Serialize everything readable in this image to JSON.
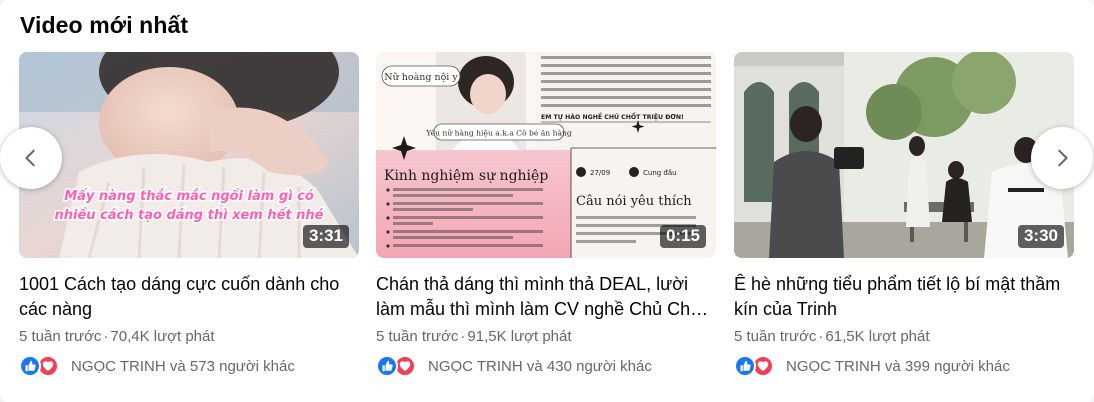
{
  "section": {
    "title": "Video mới nhất"
  },
  "colors": {
    "like": "#1877f2",
    "love": "#f33e58",
    "meta_text": "#65676b"
  },
  "videos": [
    {
      "duration": "3:31",
      "thumb_caption": "Mấy nàng thắc mắc ngồi làm gì có nhiều cách tạo dáng thì xem hết nhé",
      "title": "1001 Cách tạo dáng cực cuốn dành cho các nàng",
      "age": "5 tuần trước",
      "views": "70,4K lượt phát",
      "reactions_text": "NGỌC TRINH và 573 người khác"
    },
    {
      "duration": "0:15",
      "thumb_text": {
        "tag1": "Nữ hoàng nội y",
        "tag2": "Yêu nữ hàng hiệu a.k.a Cô bé ăn hàng",
        "heading_left": "Kinh nghiệm sự nghiệp",
        "heading_right": "Câu nói yêu thích",
        "date": "27/09",
        "zodiac": "Cung đầu",
        "bio_highlight": "EM TỰ HÀO NGHỀ CHÚ CHỐT TRIỆU ĐƠN!"
      },
      "title": "Chán thả dáng thì mình thả DEAL, lười làm mẫu thì mình làm CV nghề Chủ Chốt Triệu Đơn",
      "age": "5 tuần trước",
      "views": "91,5K lượt phát",
      "reactions_text": "NGỌC TRINH và 430 người khác"
    },
    {
      "duration": "3:30",
      "title": "Ê hè những tiểu phẩm tiết lộ bí mật thầm kín của Trinh",
      "age": "5 tuần trước",
      "views": "61,5K lượt phát",
      "reactions_text": "NGỌC TRINH và 399 người khác"
    }
  ],
  "meta_separator": "·",
  "icons": {
    "prev": "chevron-left-icon",
    "next": "chevron-right-icon",
    "like": "thumbs-up-icon",
    "love": "heart-icon"
  }
}
